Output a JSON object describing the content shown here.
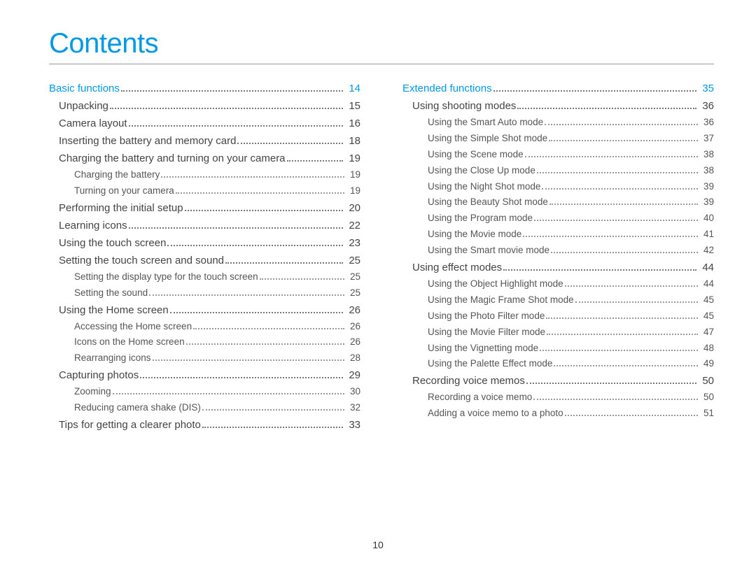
{
  "title": "Contents",
  "page_number": "10",
  "left": [
    {
      "label": "Basic functions",
      "page": "14",
      "level": 0,
      "section": true
    },
    {
      "label": "Unpacking",
      "page": "15",
      "level": 1
    },
    {
      "label": "Camera layout",
      "page": "16",
      "level": 1
    },
    {
      "label": "Inserting the battery and memory card",
      "page": "18",
      "level": 1
    },
    {
      "label": "Charging the battery and turning on your camera",
      "page": "19",
      "level": 1
    },
    {
      "label": "Charging the battery",
      "page": "19",
      "level": 2
    },
    {
      "label": "Turning on your camera",
      "page": "19",
      "level": 2
    },
    {
      "label": "Performing the initial setup",
      "page": "20",
      "level": 1
    },
    {
      "label": "Learning icons",
      "page": "22",
      "level": 1
    },
    {
      "label": "Using the touch screen",
      "page": "23",
      "level": 1
    },
    {
      "label": "Setting the touch screen and sound",
      "page": "25",
      "level": 1
    },
    {
      "label": "Setting the display type for the touch screen",
      "page": "25",
      "level": 2
    },
    {
      "label": "Setting the sound",
      "page": "25",
      "level": 2
    },
    {
      "label": "Using the Home screen",
      "page": "26",
      "level": 1
    },
    {
      "label": "Accessing the Home screen",
      "page": "26",
      "level": 2
    },
    {
      "label": "Icons on the Home screen",
      "page": "26",
      "level": 2
    },
    {
      "label": "Rearranging icons",
      "page": "28",
      "level": 2
    },
    {
      "label": "Capturing photos",
      "page": "29",
      "level": 1
    },
    {
      "label": "Zooming",
      "page": "30",
      "level": 2
    },
    {
      "label": "Reducing camera shake (DIS)",
      "page": "32",
      "level": 2
    },
    {
      "label": "Tips for getting a clearer photo",
      "page": "33",
      "level": 1
    }
  ],
  "right": [
    {
      "label": "Extended functions",
      "page": "35",
      "level": 0,
      "section": true
    },
    {
      "label": "Using shooting modes",
      "page": "36",
      "level": 1
    },
    {
      "label": "Using the Smart Auto mode",
      "page": "36",
      "level": 2
    },
    {
      "label": "Using the Simple Shot mode",
      "page": "37",
      "level": 2
    },
    {
      "label": "Using the Scene mode",
      "page": "38",
      "level": 2
    },
    {
      "label": "Using the Close Up mode",
      "page": "38",
      "level": 2
    },
    {
      "label": "Using the Night Shot mode",
      "page": "39",
      "level": 2
    },
    {
      "label": "Using the Beauty Shot mode",
      "page": "39",
      "level": 2
    },
    {
      "label": "Using the Program mode",
      "page": "40",
      "level": 2
    },
    {
      "label": "Using the Movie mode",
      "page": "41",
      "level": 2
    },
    {
      "label": "Using the Smart movie mode",
      "page": "42",
      "level": 2
    },
    {
      "label": "Using effect modes",
      "page": "44",
      "level": 1
    },
    {
      "label": "Using the Object Highlight mode",
      "page": "44",
      "level": 2
    },
    {
      "label": "Using the Magic Frame Shot mode",
      "page": "45",
      "level": 2
    },
    {
      "label": "Using the Photo Filter mode",
      "page": "45",
      "level": 2
    },
    {
      "label": "Using the Movie Filter mode",
      "page": "47",
      "level": 2
    },
    {
      "label": "Using the Vignetting mode",
      "page": "48",
      "level": 2
    },
    {
      "label": "Using the Palette Effect mode",
      "page": "49",
      "level": 2
    },
    {
      "label": "Recording voice memos",
      "page": "50",
      "level": 1
    },
    {
      "label": "Recording a voice memo",
      "page": "50",
      "level": 2
    },
    {
      "label": "Adding a voice memo to a photo",
      "page": "51",
      "level": 2
    }
  ]
}
